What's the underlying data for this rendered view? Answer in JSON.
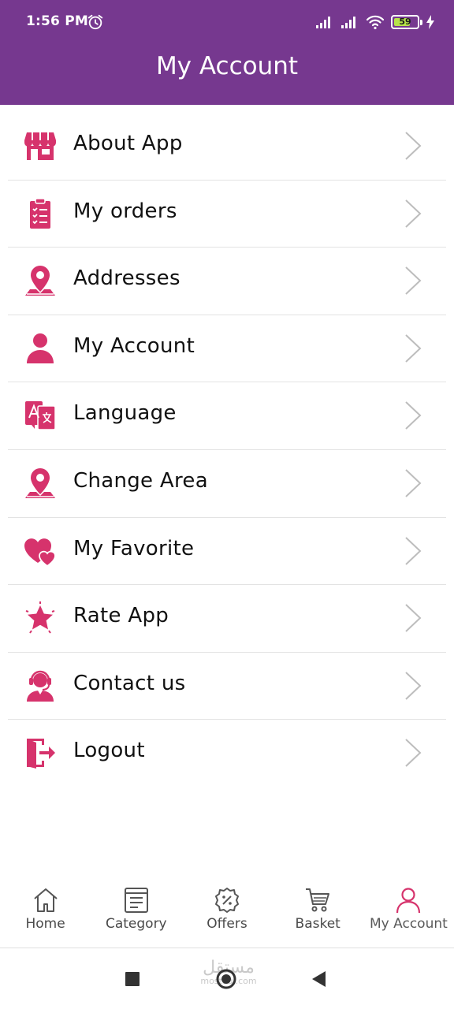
{
  "status_bar": {
    "time": "1:56 PM",
    "battery": "59",
    "alarm_icon": "alarm-clock-icon",
    "signal_icon": "signal-icon",
    "wifi_icon": "wifi-icon",
    "charging_icon": "bolt-icon"
  },
  "header": {
    "title": "My Account"
  },
  "colors": {
    "header_bg": "#76388f",
    "accent_icon": "#d6336c",
    "text": "#111111",
    "divider": "#e3e3e3",
    "battery_fill": "#b7e34a"
  },
  "menu": {
    "items": [
      {
        "label": "About App",
        "icon": "store-icon"
      },
      {
        "label": "My orders",
        "icon": "clipboard-list-icon"
      },
      {
        "label": "Addresses",
        "icon": "map-pin-icon"
      },
      {
        "label": "My Account",
        "icon": "user-icon"
      },
      {
        "label": "Language",
        "icon": "translate-icon"
      },
      {
        "label": "Change Area",
        "icon": "map-pin-icon"
      },
      {
        "label": "My Favorite",
        "icon": "hearts-icon"
      },
      {
        "label": "Rate App",
        "icon": "star-icon"
      },
      {
        "label": "Contact us",
        "icon": "headset-agent-icon"
      },
      {
        "label": "Logout",
        "icon": "logout-door-icon"
      }
    ],
    "chevron_icon": "chevron-right-icon"
  },
  "bottom_nav": {
    "items": [
      {
        "label": "Home",
        "icon": "home-icon",
        "active": false
      },
      {
        "label": "Category",
        "icon": "category-list-icon",
        "active": false
      },
      {
        "label": "Offers",
        "icon": "discount-badge-icon",
        "active": false
      },
      {
        "label": "Basket",
        "icon": "cart-icon",
        "active": false
      },
      {
        "label": "My Account",
        "icon": "user-icon",
        "active": true
      }
    ]
  },
  "system_nav": {
    "recent_icon": "square-icon",
    "home_icon": "circle-icon",
    "back_icon": "triangle-back-icon",
    "watermark_ar": "مستقل",
    "watermark_en": "mostaql.com"
  }
}
